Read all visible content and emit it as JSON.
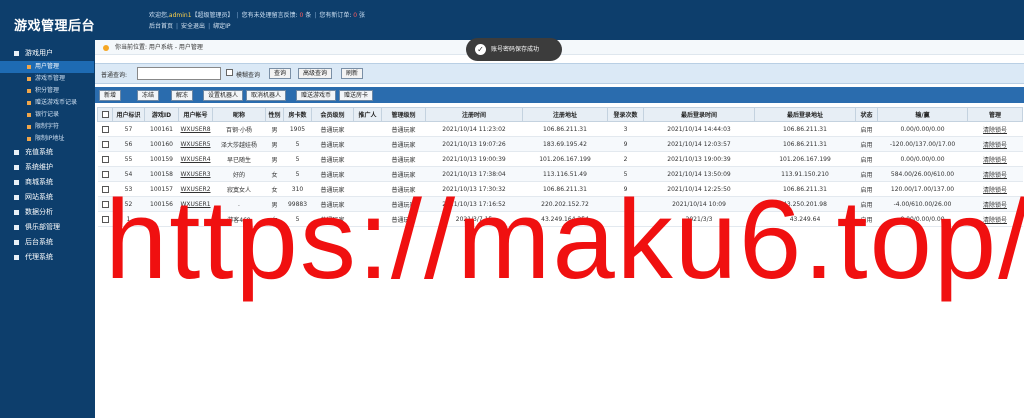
{
  "app": {
    "title": "游戏管理后台"
  },
  "top": {
    "welcome_prefix": "欢迎您,",
    "user": "admin1",
    "role": "【超级管理员】",
    "pending_label": "您有未处理留言反馈:",
    "pending_count": "0",
    "pending_unit": "条",
    "orders_label": "您有新订单:",
    "orders_count": "0",
    "orders_unit": "张",
    "links": [
      "后台首页",
      "安全退出",
      "绑定IP"
    ]
  },
  "sidebar": {
    "groups": [
      {
        "label": "游戏用户",
        "items": [
          "用户管理",
          "游戏币管理",
          "积分管理",
          "赠送游戏币记录",
          "银行记录",
          "限制字符",
          "限制IP地址"
        ]
      },
      {
        "label": "充值系统"
      },
      {
        "label": "系统维护"
      },
      {
        "label": "商城系统"
      },
      {
        "label": "网站系统"
      },
      {
        "label": "数据分析"
      },
      {
        "label": "俱乐部管理"
      },
      {
        "label": "后台系统"
      },
      {
        "label": "代理系统"
      }
    ],
    "active_item": "用户管理"
  },
  "breadcrumb": {
    "text": "你当前位置: 用户系统 - 用户管理"
  },
  "search": {
    "label": "普通查询:",
    "input_value": "",
    "fuzzy_label": "模糊查询",
    "buttons": [
      "查询",
      "高级查询",
      "刷新"
    ]
  },
  "toolbar": {
    "buttons": [
      "新增",
      "冻结",
      "解冻",
      "设置机器人",
      "取消机器人",
      "赠送游戏币",
      "赠送房卡"
    ]
  },
  "table": {
    "headers": [
      "用户标识",
      "游戏ID",
      "用户帐号",
      "昵称",
      "性别",
      "房卡数",
      "会员级别",
      "推广人",
      "管理级别",
      "注册时间",
      "注册地址",
      "登录次数",
      "最后登录时间",
      "最后登录地址",
      "状态",
      "输/赢",
      "管理"
    ],
    "rows": [
      [
        "57",
        "100161",
        "WXUSER8",
        "百钢·小杨",
        "男",
        "1905",
        "普通玩家",
        "",
        "普通玩家",
        "2021/10/14 11:23:02",
        "106.86.211.31",
        "3",
        "2021/10/14 14:44:03",
        "106.86.211.31",
        "启用",
        "0.00/0.00/0.00",
        "清除锁号"
      ],
      [
        "56",
        "100160",
        "WXUSER5",
        "泽大莎越娃杨",
        "男",
        "5",
        "普通玩家",
        "",
        "普通玩家",
        "2021/10/13 19:07:26",
        "183.69.195.42",
        "9",
        "2021/10/14 12:03:57",
        "106.86.211.31",
        "启用",
        "-120.00/137.00/17.00",
        "清除锁号"
      ],
      [
        "55",
        "100159",
        "WXUSER4",
        "早已随生",
        "男",
        "5",
        "普通玩家",
        "",
        "普通玩家",
        "2021/10/13 19:00:39",
        "101.206.167.199",
        "2",
        "2021/10/13 19:00:39",
        "101.206.167.199",
        "启用",
        "0.00/0.00/0.00",
        "清除锁号"
      ],
      [
        "54",
        "100158",
        "WXUSER3",
        "好的",
        "女",
        "5",
        "普通玩家",
        "",
        "普通玩家",
        "2021/10/13 17:38:04",
        "113.116.51.49",
        "5",
        "2021/10/14 13:50:09",
        "113.91.150.210",
        "启用",
        "584.00/26.00/610.00",
        "清除锁号"
      ],
      [
        "53",
        "100157",
        "WXUSER2",
        "寂寞女人",
        "女",
        "310",
        "普通玩家",
        "",
        "普通玩家",
        "2021/10/13 17:30:32",
        "106.86.211.31",
        "9",
        "2021/10/14 12:25:50",
        "106.86.211.31",
        "启用",
        "120.00/17.00/137.00",
        "清除锁号"
      ],
      [
        "52",
        "100156",
        "WXUSER1",
        ".",
        "男",
        "99883",
        "普通玩家",
        "",
        "普通玩家",
        "2021/10/13 17:16:52",
        "220.202.152.72",
        "",
        "2021/10/14 10:09",
        "43.250.201.98",
        "启用",
        "-4.00/610.00/26.00",
        "清除锁号"
      ],
      [
        "1",
        "",
        "",
        "游客469",
        "女",
        "5",
        "普通玩家",
        "",
        "普通玩家",
        "2021/3/7 15",
        "43.249.164.254",
        "",
        "2021/3/3",
        "43.249.64",
        "启用",
        "0.00/0.00/0.00",
        "清除锁号"
      ]
    ]
  },
  "toast": {
    "message": "账号密码保存成功"
  },
  "watermark": {
    "text": "https://maku6.top/"
  }
}
